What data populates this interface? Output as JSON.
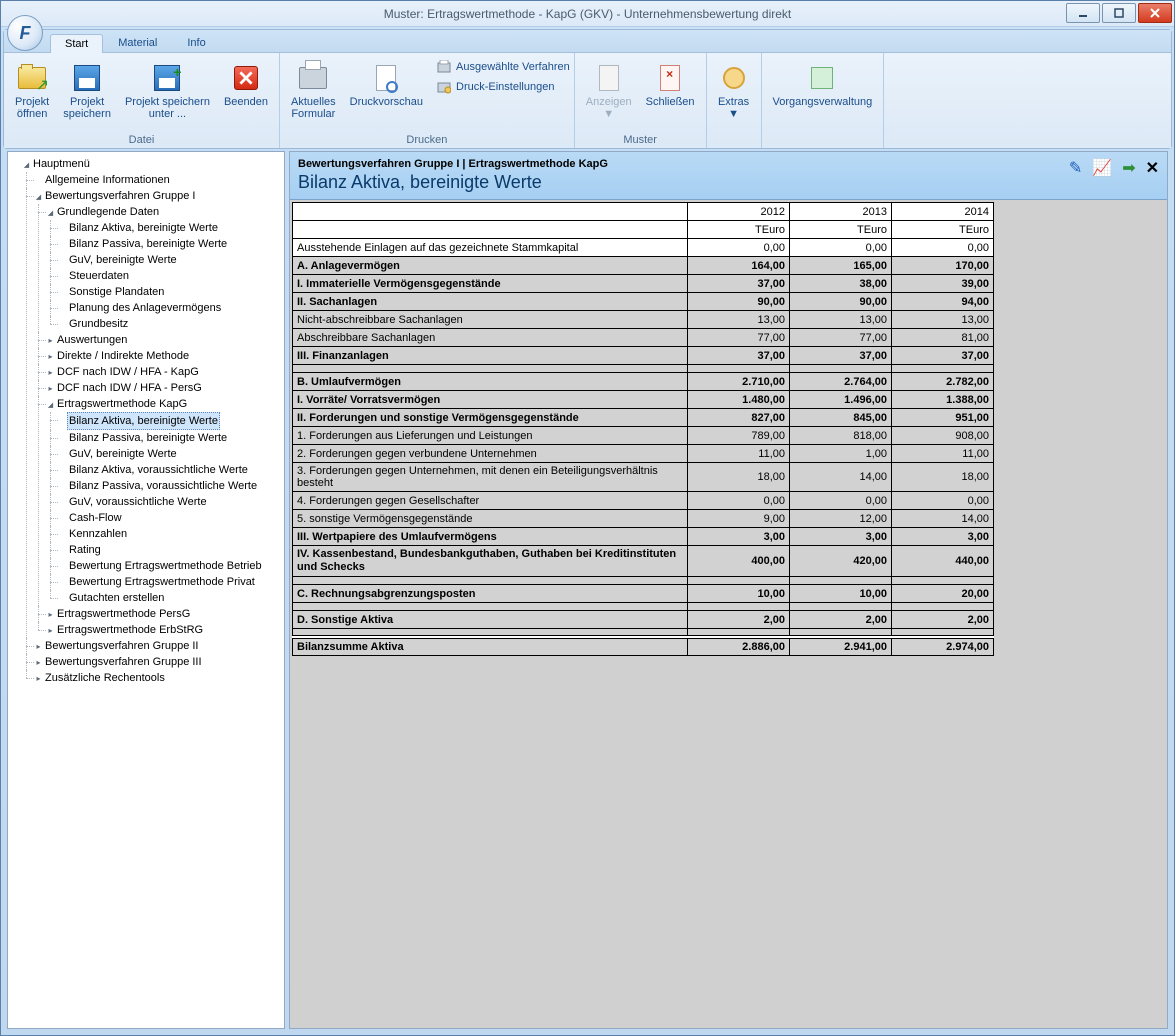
{
  "window": {
    "title": "Muster: Ertragswertmethode - KapG (GKV) - Unternehmensbewertung direkt"
  },
  "tabs": {
    "start": "Start",
    "material": "Material",
    "info": "Info"
  },
  "ribbon": {
    "datei": {
      "label": "Datei",
      "open": "Projekt\nöffnen",
      "save": "Projekt\nspeichern",
      "saveas": "Projekt speichern\nunter ...",
      "quit": "Beenden"
    },
    "drucken": {
      "label": "Drucken",
      "current": "Aktuelles\nFormular",
      "preview": "Druckvorschau",
      "sel": "Ausgewählte Verfahren",
      "settings": "Druck-Einstellungen"
    },
    "muster": {
      "label": "Muster",
      "show": "Anzeigen",
      "close": "Schließen"
    },
    "extras": {
      "label": "",
      "btn": "Extras"
    },
    "vorgang": {
      "label": "",
      "btn": "Vorgangsverwaltung"
    }
  },
  "tree": {
    "root": "Hauptmenü",
    "allg": "Allgemeine Informationen",
    "g1": "Bewertungsverfahren Gruppe I",
    "g1_grund": "Grundlegende Daten",
    "g1_grund_items": [
      "Bilanz Aktiva, bereinigte Werte",
      "Bilanz Passiva, bereinigte Werte",
      "GuV, bereinigte Werte",
      "Steuerdaten",
      "Sonstige Plandaten",
      "Planung des Anlagevermögens",
      "Grundbesitz"
    ],
    "g1_ausw": "Auswertungen",
    "g1_dim": "Direkte / Indirekte Methode",
    "g1_dcfk": "DCF nach IDW / HFA - KapG",
    "g1_dcfp": "DCF nach IDW / HFA - PersG",
    "g1_ewm": "Ertragswertmethode KapG",
    "g1_ewm_items": [
      "Bilanz Aktiva, bereinigte Werte",
      "Bilanz Passiva, bereinigte Werte",
      "GuV, bereinigte Werte",
      "Bilanz Aktiva, voraussichtliche Werte",
      "Bilanz Passiva, voraussichtliche Werte",
      "GuV, voraussichtliche Werte",
      "Cash-Flow",
      "Kennzahlen",
      "Rating",
      "Bewertung Ertragswertmethode Betrieb",
      "Bewertung Ertragswertmethode Privat",
      "Gutachten erstellen"
    ],
    "g1_ewmp": "Ertragswertmethode PersG",
    "g1_ewme": "Ertragswertmethode ErbStRG",
    "g2": "Bewertungsverfahren Gruppe II",
    "g3": "Bewertungsverfahren Gruppe III",
    "tools": "Zusätzliche Rechentools"
  },
  "content": {
    "breadcrumb": "Bewertungsverfahren Gruppe I | Ertragswertmethode KapG",
    "title": "Bilanz Aktiva, bereinigte Werte",
    "years": [
      "2012",
      "2013",
      "2014"
    ],
    "unit": "TEuro",
    "rows": [
      {
        "label": "Ausstehende Einlagen auf das gezeichnete Stammkapital",
        "v": [
          "0,00",
          "0,00",
          "0,00"
        ],
        "bold": false,
        "shade": false
      },
      {
        "label": "A. Anlagevermögen",
        "v": [
          "164,00",
          "165,00",
          "170,00"
        ],
        "bold": true,
        "shade": true
      },
      {
        "label": "I. Immaterielle Vermögensgegenstände",
        "v": [
          "37,00",
          "38,00",
          "39,00"
        ],
        "bold": true,
        "shade": true
      },
      {
        "label": "II. Sachanlagen",
        "v": [
          "90,00",
          "90,00",
          "94,00"
        ],
        "bold": true,
        "shade": true
      },
      {
        "label": "Nicht-abschreibbare Sachanlagen",
        "v": [
          "13,00",
          "13,00",
          "13,00"
        ],
        "bold": false,
        "shade": true
      },
      {
        "label": "Abschreibbare Sachanlagen",
        "v": [
          "77,00",
          "77,00",
          "81,00"
        ],
        "bold": false,
        "shade": true
      },
      {
        "label": "III. Finanzanlagen",
        "v": [
          "37,00",
          "37,00",
          "37,00"
        ],
        "bold": true,
        "shade": true
      },
      {
        "spacer": true,
        "shade": true
      },
      {
        "label": "B. Umlaufvermögen",
        "v": [
          "2.710,00",
          "2.764,00",
          "2.782,00"
        ],
        "bold": true,
        "shade": true
      },
      {
        "label": "I. Vorräte/ Vorratsvermögen",
        "v": [
          "1.480,00",
          "1.496,00",
          "1.388,00"
        ],
        "bold": true,
        "shade": true
      },
      {
        "label": "II. Forderungen und sonstige Vermögensgegenstände",
        "v": [
          "827,00",
          "845,00",
          "951,00"
        ],
        "bold": true,
        "shade": true
      },
      {
        "label": "1. Forderungen aus Lieferungen und Leistungen",
        "v": [
          "789,00",
          "818,00",
          "908,00"
        ],
        "bold": false,
        "shade": true
      },
      {
        "label": "2. Forderungen gegen verbundene Unternehmen",
        "v": [
          "11,00",
          "1,00",
          "11,00"
        ],
        "bold": false,
        "shade": true
      },
      {
        "label": "3. Forderungen gegen Unternehmen, mit denen ein Beteiligungsverhältnis besteht",
        "v": [
          "18,00",
          "14,00",
          "18,00"
        ],
        "bold": false,
        "shade": true
      },
      {
        "label": "4. Forderungen gegen Gesellschafter",
        "v": [
          "0,00",
          "0,00",
          "0,00"
        ],
        "bold": false,
        "shade": true
      },
      {
        "label": "5. sonstige Vermögensgegenstände",
        "v": [
          "9,00",
          "12,00",
          "14,00"
        ],
        "bold": false,
        "shade": true
      },
      {
        "label": "III. Wertpapiere des Umlaufvermögens",
        "v": [
          "3,00",
          "3,00",
          "3,00"
        ],
        "bold": true,
        "shade": true
      },
      {
        "label": "IV. Kassenbestand, Bundesbankguthaben, Guthaben bei Kreditinstituten und Schecks",
        "v": [
          "400,00",
          "420,00",
          "440,00"
        ],
        "bold": true,
        "shade": true,
        "multi": true
      },
      {
        "spacer": true,
        "shade": true
      },
      {
        "label": "C. Rechnungsabgrenzungsposten",
        "v": [
          "10,00",
          "10,00",
          "20,00"
        ],
        "bold": true,
        "shade": true
      },
      {
        "spacer": true,
        "shade": true
      },
      {
        "label": "D. Sonstige Aktiva",
        "v": [
          "2,00",
          "2,00",
          "2,00"
        ],
        "bold": true,
        "shade": true
      },
      {
        "spacer": true,
        "shade": true
      },
      {
        "label": "Bilanzsumme Aktiva",
        "v": [
          "2.886,00",
          "2.941,00",
          "2.974,00"
        ],
        "bold": true,
        "shade": true,
        "summary": true
      }
    ]
  }
}
